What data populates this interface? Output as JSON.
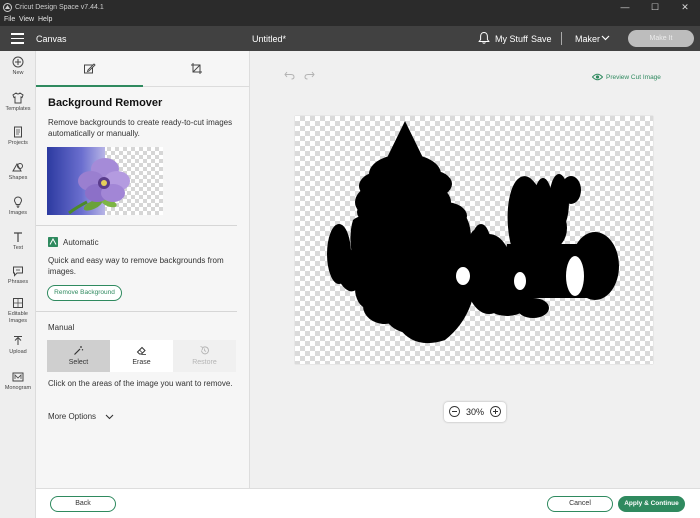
{
  "window": {
    "title": "Cricut Design Space  v7.44.1",
    "controls": {
      "minimize": "—",
      "maximize": "☐",
      "close": "✕"
    }
  },
  "menu": {
    "items": [
      "File",
      "View",
      "Help"
    ]
  },
  "header": {
    "canvas_label": "Canvas",
    "doc_title": "Untitled*",
    "my_stuff": "My Stuff",
    "save": "Save",
    "machine": "Maker",
    "make_it": "Make It"
  },
  "rail": {
    "items": [
      {
        "label": "New",
        "icon": "plus-circle-icon"
      },
      {
        "label": "Templates",
        "icon": "shirt-icon"
      },
      {
        "label": "Projects",
        "icon": "projects-icon"
      },
      {
        "label": "Shapes",
        "icon": "shapes-icon"
      },
      {
        "label": "Images",
        "icon": "lightbulb-icon"
      },
      {
        "label": "Text",
        "icon": "text-icon"
      },
      {
        "label": "Phrases",
        "icon": "speech-bubble-icon"
      },
      {
        "label": "Editable Images",
        "icon": "editable-images-icon"
      },
      {
        "label": "Upload",
        "icon": "upload-icon"
      },
      {
        "label": "Monogram",
        "icon": "monogram-icon"
      }
    ]
  },
  "panel": {
    "tabs": [
      {
        "name": "edit",
        "icon": "edit-icon",
        "active": true
      },
      {
        "name": "crop",
        "icon": "crop-icon",
        "active": false
      }
    ],
    "title": "Background Remover",
    "description": "Remove backgrounds to create ready-to-cut images automatically or manually.",
    "automatic": {
      "label": "Automatic",
      "description": "Quick and easy way to remove backgrounds from images.",
      "button": "Remove Background"
    },
    "manual": {
      "label": "Manual",
      "tools": [
        {
          "label": "Select",
          "icon": "magic-wand-icon",
          "state": "active"
        },
        {
          "label": "Erase",
          "icon": "eraser-icon",
          "state": "normal"
        },
        {
          "label": "Restore",
          "icon": "restore-icon",
          "state": "disabled"
        }
      ],
      "hint": "Click on the areas of the image you want to remove."
    },
    "more_options": "More Options"
  },
  "canvas": {
    "preview_cut": "Preview Cut Image",
    "zoom": "30%",
    "zoom_out": "−",
    "zoom_in": "+"
  },
  "footer": {
    "back": "Back",
    "cancel": "Cancel",
    "apply": "Apply & Continue"
  },
  "colors": {
    "accent": "#2f8a5f",
    "header_bg": "#414141",
    "titlebar_bg": "#2b2b2b"
  }
}
